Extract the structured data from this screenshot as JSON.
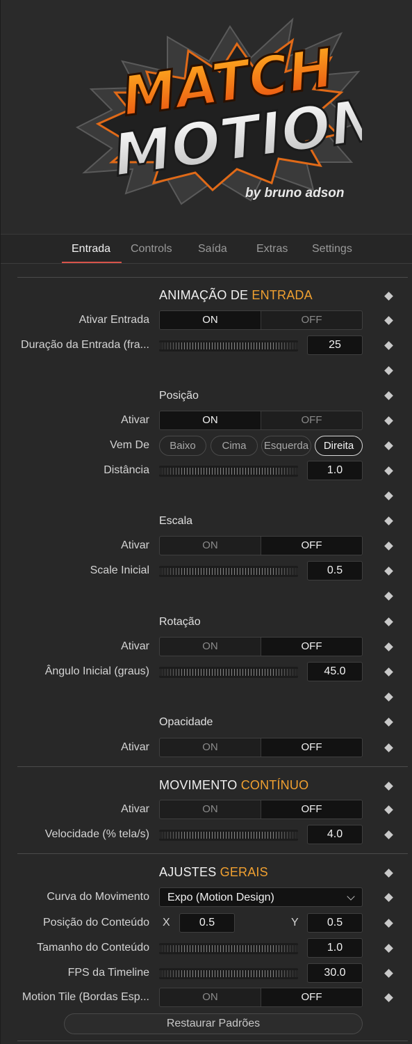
{
  "logo": {
    "line1": "MATCH",
    "line2": "MOTION",
    "byline": "by bruno adson"
  },
  "tabs": [
    {
      "label": "Entrada",
      "active": true
    },
    {
      "label": "Controls",
      "active": false
    },
    {
      "label": "Saída",
      "active": false
    },
    {
      "label": "Extras",
      "active": false
    },
    {
      "label": "Settings",
      "active": false
    }
  ],
  "entrada": {
    "title_main": "ANIMAÇÃO DE",
    "title_accent": "ENTRADA",
    "ativar_entrada": {
      "label": "Ativar Entrada",
      "on": "ON",
      "off": "OFF",
      "value": "ON"
    },
    "duracao": {
      "label": "Duração da Entrada (fra...",
      "value": "25"
    },
    "posicao": {
      "title": "Posição",
      "ativar": {
        "label": "Ativar",
        "on": "ON",
        "off": "OFF",
        "value": "ON"
      },
      "vem_de": {
        "label": "Vem De",
        "options": [
          "Baixo",
          "Cima",
          "Esquerda",
          "Direita"
        ],
        "selected": "Direita"
      },
      "distancia": {
        "label": "Distância",
        "value": "1.0"
      }
    },
    "escala": {
      "title": "Escala",
      "ativar": {
        "label": "Ativar",
        "on": "ON",
        "off": "OFF",
        "value": "OFF"
      },
      "scale_inicial": {
        "label": "Scale Inicial",
        "value": "0.5"
      }
    },
    "rotacao": {
      "title": "Rotação",
      "ativar": {
        "label": "Ativar",
        "on": "ON",
        "off": "OFF",
        "value": "OFF"
      },
      "angulo": {
        "label": "Ângulo Inicial (graus)",
        "value": "45.0"
      }
    },
    "opacidade": {
      "title": "Opacidade",
      "ativar": {
        "label": "Ativar",
        "on": "ON",
        "off": "OFF",
        "value": "OFF"
      }
    }
  },
  "movimento": {
    "title_main": "MOVIMENTO",
    "title_accent": "CONTÍNUO",
    "ativar": {
      "label": "Ativar",
      "on": "ON",
      "off": "OFF",
      "value": "OFF"
    },
    "velocidade": {
      "label": "Velocidade (% tela/s)",
      "value": "4.0"
    }
  },
  "ajustes": {
    "title_main": "AJUSTES",
    "title_accent": "GERAIS",
    "curva": {
      "label": "Curva do Movimento",
      "value": "Expo (Motion Design)"
    },
    "posicao_conteudo": {
      "label": "Posição do Conteúdo",
      "x_label": "X",
      "x": "0.5",
      "y_label": "Y",
      "y": "0.5"
    },
    "tamanho": {
      "label": "Tamanho do Conteúdo",
      "value": "1.0"
    },
    "fps": {
      "label": "FPS da Timeline",
      "value": "30.0"
    },
    "motion_tile": {
      "label": "Motion Tile (Bordas Esp...",
      "on": "ON",
      "off": "OFF",
      "value": "OFF"
    },
    "reset_label": "Restaurar Padrões"
  },
  "colors": {
    "accent": "#f0a030",
    "tab_underline": "#d8534a",
    "background": "#282828"
  },
  "icons": {
    "keyframe": "keyframe-diamond-icon",
    "dropdown": "chevron-down-icon"
  }
}
